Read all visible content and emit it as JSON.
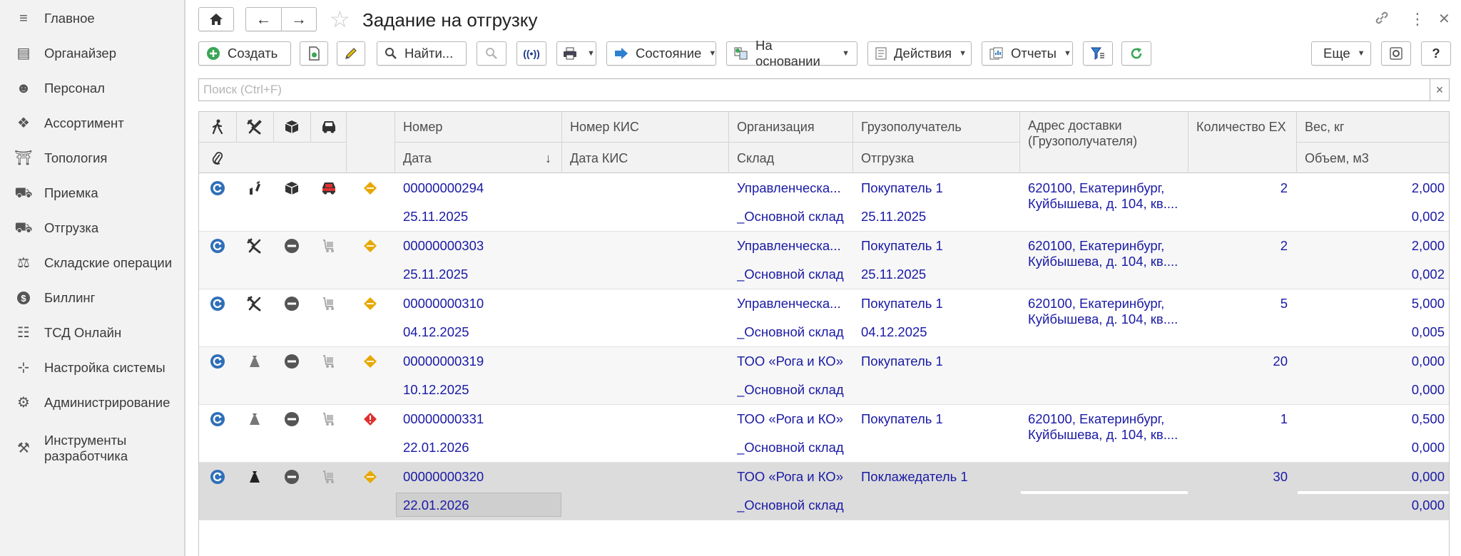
{
  "window": {
    "title": "Задание на отгрузку"
  },
  "sidebar": {
    "items": [
      {
        "label": "Главное",
        "icon": "menu-icon"
      },
      {
        "label": "Органайзер",
        "icon": "notepad-icon"
      },
      {
        "label": "Персонал",
        "icon": "people-icon"
      },
      {
        "label": "Ассортимент",
        "icon": "boxes-icon"
      },
      {
        "label": "Топология",
        "icon": "warehouse-icon"
      },
      {
        "label": "Приемка",
        "icon": "truck-icon"
      },
      {
        "label": "Отгрузка",
        "icon": "shipping-truck-icon"
      },
      {
        "label": "Складские операции",
        "icon": "scale-icon"
      },
      {
        "label": "Биллинг",
        "icon": "dollar-icon"
      },
      {
        "label": "ТСД Онлайн",
        "icon": "scanner-icon"
      },
      {
        "label": "Настройка системы",
        "icon": "sliders-icon"
      },
      {
        "label": "Администрирование",
        "icon": "gear-icon"
      },
      {
        "label": "Инструменты\nразработчика",
        "icon": "wrench-icon"
      }
    ]
  },
  "toolbar": {
    "create": "Создать",
    "find": "Найти...",
    "state": "Состояние",
    "based_on": "На основании",
    "actions": "Действия",
    "reports": "Отчеты",
    "more": "Еще",
    "help": "?"
  },
  "search": {
    "placeholder": "Поиск (Ctrl+F)"
  },
  "columns": {
    "number": "Номер",
    "date": "Дата",
    "kis_number": "Номер КИС",
    "kis_date": "Дата КИС",
    "organization": "Организация",
    "warehouse": "Склад",
    "consignee": "Грузополучатель",
    "shipment": "Отгрузка",
    "address": "Адрес доставки (Грузополучателя)",
    "qty": "Количество ЕХ",
    "weight": "Вес, кг",
    "volume": "Объем, м3"
  },
  "rows": [
    {
      "number": "00000000294",
      "date": "25.11.2025",
      "org": "Управленческа...",
      "warehouse": "_Основной склад",
      "consignee": "Покупатель 1",
      "shipment": "25.11.2025",
      "address": "620100, Екатеринбург, Куйбышева, д. 104, кв....",
      "qty": "2",
      "weight": "2,000",
      "volume": "0,002",
      "status_color": "#e8a800",
      "state": "done"
    },
    {
      "number": "00000000303",
      "date": "25.11.2025",
      "org": "Управленческа...",
      "warehouse": "_Основной склад",
      "consignee": "Покупатель 1",
      "shipment": "25.11.2025",
      "address": "620100, Екатеринбург, Куйбышева, д. 104, кв....",
      "qty": "2",
      "weight": "2,000",
      "volume": "0,002",
      "status_color": "#e8a800",
      "state": "pick"
    },
    {
      "number": "00000000310",
      "date": "04.12.2025",
      "org": "Управленческа...",
      "warehouse": "_Основной склад",
      "consignee": "Покупатель 1",
      "shipment": "04.12.2025",
      "address": "620100, Екатеринбург, Куйбышева, д. 104, кв....",
      "qty": "5",
      "weight": "5,000",
      "volume": "0,005",
      "status_color": "#e8a800",
      "state": "pick"
    },
    {
      "number": "00000000319",
      "date": "10.12.2025",
      "org": "ТОО «Рога и КО»",
      "warehouse": "_Основной склад",
      "consignee": "Покупатель 1",
      "shipment": "",
      "address": "",
      "qty": "20",
      "weight": "0,000",
      "volume": "0,000",
      "status_color": "#e8a800",
      "state": "bag"
    },
    {
      "number": "00000000331",
      "date": "22.01.2026",
      "org": "ТОО «Рога и КО»",
      "warehouse": "_Основной склад",
      "consignee": "Покупатель 1",
      "shipment": "",
      "address": "620100, Екатеринбург, Куйбышева, д. 104, кв....",
      "qty": "1",
      "weight": "0,500",
      "volume": "0,000",
      "status_color": "#e03030",
      "state": "bag"
    },
    {
      "number": "00000000320",
      "date": "22.01.2026",
      "org": "ТОО «Рога и КО»",
      "warehouse": "_Основной склад",
      "consignee": "Поклажедатель 1",
      "shipment": "",
      "address": "",
      "qty": "30",
      "weight": "0,000",
      "volume": "0,000",
      "status_color": "#e8a800",
      "state": "bag-dark"
    }
  ],
  "colors": {
    "link": "#1a1aa6",
    "accent_green": "#3aa655",
    "selected_row": "#dcdcdc"
  }
}
